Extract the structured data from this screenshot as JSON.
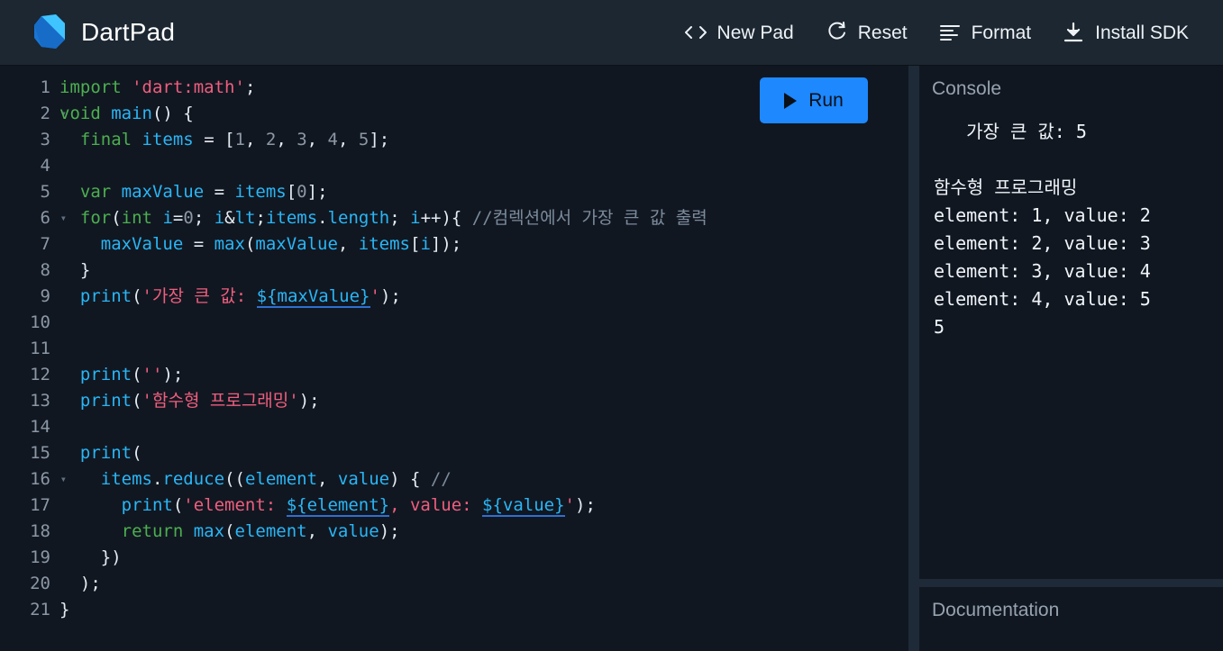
{
  "header": {
    "brand": "DartPad",
    "logo_icon": "dart-logo-icon",
    "actions": [
      {
        "label": "New Pad",
        "icon": "code-brackets-icon"
      },
      {
        "label": "Reset",
        "icon": "refresh-icon"
      },
      {
        "label": "Format",
        "icon": "format-lines-icon"
      },
      {
        "label": "Install SDK",
        "icon": "download-icon"
      }
    ]
  },
  "editor": {
    "run_label": "Run",
    "run_icon": "play-triangle-icon",
    "lines": [
      {
        "n": "1",
        "fold": ""
      },
      {
        "n": "2",
        "fold": "▾"
      },
      {
        "n": "3",
        "fold": ""
      },
      {
        "n": "4",
        "fold": ""
      },
      {
        "n": "5",
        "fold": ""
      },
      {
        "n": "6",
        "fold": "▾"
      },
      {
        "n": "7",
        "fold": ""
      },
      {
        "n": "8",
        "fold": ""
      },
      {
        "n": "9",
        "fold": ""
      },
      {
        "n": "10",
        "fold": ""
      },
      {
        "n": "11",
        "fold": ""
      },
      {
        "n": "12",
        "fold": ""
      },
      {
        "n": "13",
        "fold": ""
      },
      {
        "n": "14",
        "fold": ""
      },
      {
        "n": "15",
        "fold": ""
      },
      {
        "n": "16",
        "fold": "▾"
      },
      {
        "n": "17",
        "fold": ""
      },
      {
        "n": "18",
        "fold": ""
      },
      {
        "n": "19",
        "fold": ""
      },
      {
        "n": "20",
        "fold": ""
      },
      {
        "n": "21",
        "fold": ""
      }
    ],
    "code_text": [
      "import 'dart:math';",
      "void main() {",
      "  final items = [1, 2, 3, 4, 5];",
      "",
      "  var maxValue = items[0];",
      "  for(int i=0; i<items.length; i++){ //컴렉션에서 가장 큰 값 출력",
      "    maxValue = max(maxValue, items[i]);",
      "  }",
      "  print('가장 큰 값: ${maxValue}');",
      "",
      "",
      "  print('');",
      "  print('함수형 프로그래밍');",
      "",
      "  print(",
      "    items.reduce((element, value) { //",
      "      print('element: ${element}, value: ${value}');",
      "      return max(element, value);",
      "    })",
      "  );",
      "}"
    ]
  },
  "console": {
    "title": "Console",
    "output_lines": [
      "   가장 큰 값: 5",
      "",
      "함수형 프로그래밍",
      "element: 1, value: 2",
      "element: 2, value: 3",
      "element: 3, value: 4",
      "element: 4, value: 5",
      "5"
    ]
  },
  "documentation": {
    "title": "Documentation"
  },
  "colors": {
    "header_bg": "#1c2731",
    "editor_bg": "#111721",
    "divider": "#1e2a38",
    "accent_run": "#1e88ff",
    "keyword": "#4caf50",
    "string": "#ef5e7e",
    "identifier": "#29b6f6",
    "number": "#8c98a5",
    "comment": "#7b8b9c",
    "logo_light": "#40c4ff",
    "logo_dark": "#1565c0"
  }
}
